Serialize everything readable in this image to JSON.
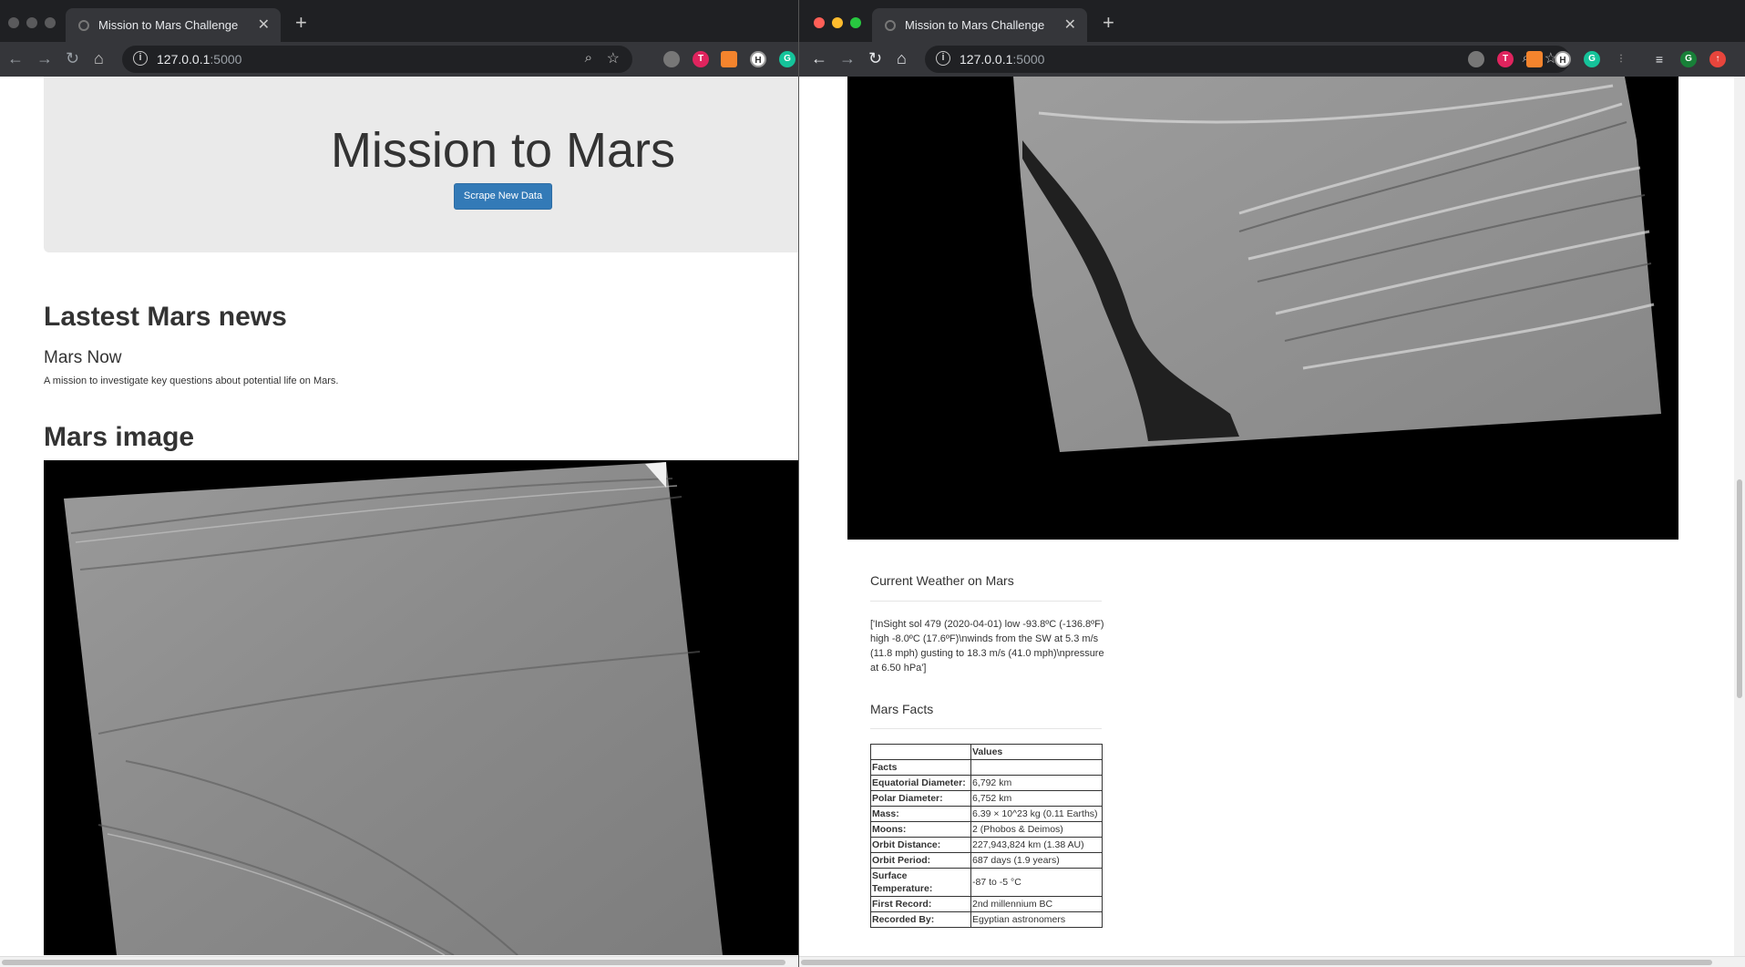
{
  "left_window": {
    "tab_title": "Mission to Mars Challenge",
    "url_host": "127.0.0.1",
    "url_port": ":5000",
    "page": {
      "heading": "Mission to Mars",
      "scrape_button": "Scrape New Data",
      "news_heading": "Lastest Mars news",
      "news_title": "Mars Now",
      "news_paragraph": "A mission to investigate key questions about potential life on Mars.",
      "image_heading": "Mars image"
    }
  },
  "right_window": {
    "tab_title": "Mission to Mars Challenge",
    "url_host": "127.0.0.1",
    "url_port": ":5000",
    "weather_heading": "Current Weather on Mars",
    "weather_text": "['InSight sol 479 (2020-04-01) low -93.8ºC (-136.8ºF) high -8.0ºC (17.6ºF)\\nwinds from the SW at 5.3 m/s (11.8 mph) gusting to 18.3 m/s (41.0 mph)\\npressure at 6.50 hPa']",
    "facts_heading": "Mars Facts",
    "facts_table": {
      "header_blank": "",
      "header_values": "Values",
      "index_label": "Facts",
      "rows": [
        {
          "label": "Equatorial Diameter:",
          "value": "6,792 km"
        },
        {
          "label": "Polar Diameter:",
          "value": "6,752 km"
        },
        {
          "label": "Mass:",
          "value": "6.39 × 10^23 kg (0.11 Earths)"
        },
        {
          "label": "Moons:",
          "value": "2 (Phobos & Deimos)"
        },
        {
          "label": "Orbit Distance:",
          "value": "227,943,824 km (1.38 AU)"
        },
        {
          "label": "Orbit Period:",
          "value": "687 days (1.9 years)"
        },
        {
          "label": "Surface Temperature:",
          "value": "-87 to -5 °C"
        },
        {
          "label": "First Record:",
          "value": "2nd millennium BC"
        },
        {
          "label": "Recorded By:",
          "value": "Egyptian astronomers"
        }
      ]
    }
  },
  "colors": {
    "titlebar": "#1f2023",
    "toolbar": "#35363a",
    "jumbotron": "#eaeaea",
    "primary_button": "#337ab7"
  }
}
